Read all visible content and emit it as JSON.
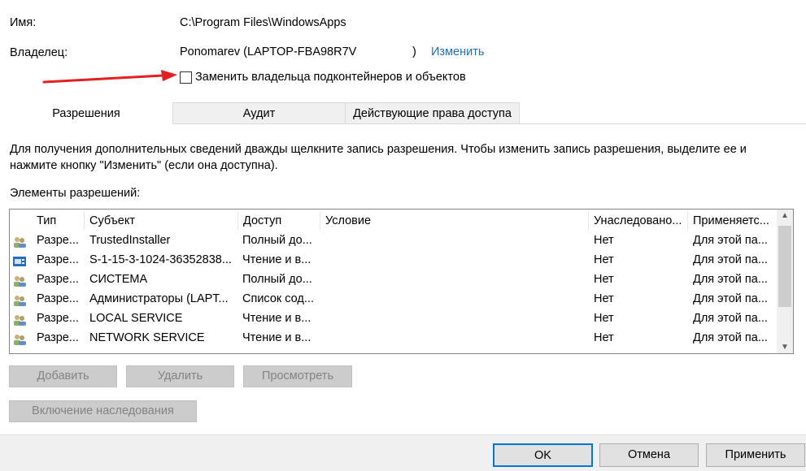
{
  "name_label": "Имя:",
  "name_value": "C:\\Program Files\\WindowsApps",
  "owner_label": "Владелец:",
  "owner_value": "Ponomarev (LAPTOP-FBA98R7V",
  "owner_suffix": ")",
  "change_link": "Изменить",
  "replace_owner_checkbox": {
    "label": "Заменить владельца подконтейнеров и объектов",
    "checked": false
  },
  "annotation_arrow_color": "#e3201f",
  "tabs": [
    {
      "label": "Разрешения",
      "selected": true
    },
    {
      "label": "Аудит"
    },
    {
      "label": "Действующие права доступа"
    }
  ],
  "info_text_1": "Для получения дополнительных сведений дважды щелкните запись разрешения. Чтобы изменить запись разрешения, выделите ее и",
  "info_text_2": "нажмите кнопку \"Изменить\" (если она доступна).",
  "entries_label": "Элементы разрешений:",
  "columns": [
    "Тип",
    "Субъект",
    "Доступ",
    "Условие",
    "Унаследовано...",
    "Применяетс..."
  ],
  "rows": [
    {
      "icon": "users-icon",
      "type": "Разре...",
      "principal": "TrustedInstaller",
      "access": "Полный до...",
      "condition": "",
      "inherited": "Нет",
      "applies": "Для этой па..."
    },
    {
      "icon": "app-package-icon",
      "type": "Разре...",
      "principal": "S-1-15-3-1024-36352838...",
      "access": "Чтение и в...",
      "condition": "",
      "inherited": "Нет",
      "applies": "Для этой па..."
    },
    {
      "icon": "users-icon",
      "type": "Разре...",
      "principal": "СИСТЕМА",
      "access": "Полный до...",
      "condition": "",
      "inherited": "Нет",
      "applies": "Для этой па..."
    },
    {
      "icon": "users-icon",
      "type": "Разре...",
      "principal": "Администраторы (LAPT...",
      "access": "Список сод...",
      "condition": "",
      "inherited": "Нет",
      "applies": "Для этой па..."
    },
    {
      "icon": "users-icon",
      "type": "Разре...",
      "principal": "LOCAL SERVICE",
      "access": "Чтение и в...",
      "condition": "",
      "inherited": "Нет",
      "applies": "Для этой па..."
    },
    {
      "icon": "users-icon",
      "type": "Разре...",
      "principal": "NETWORK SERVICE",
      "access": "Чтение и в...",
      "condition": "",
      "inherited": "Нет",
      "applies": "Для этой па..."
    }
  ],
  "buttons": {
    "add": "Добавить",
    "remove": "Удалить",
    "view": "Просмотреть",
    "enable_inheritance": "Включение наследования"
  },
  "footer": {
    "ok": "OK",
    "cancel": "Отмена",
    "apply": "Применить"
  }
}
